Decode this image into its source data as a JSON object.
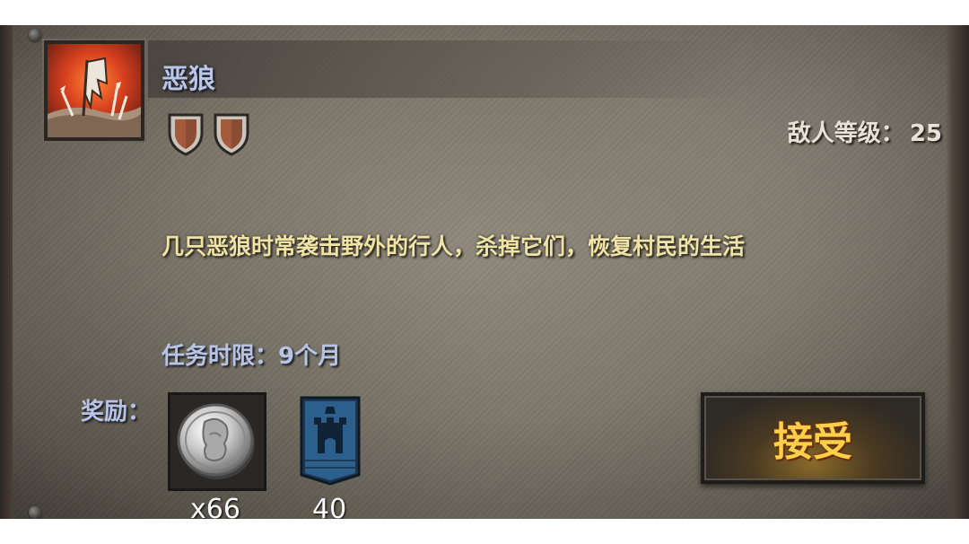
{
  "quest": {
    "title": "恶狼",
    "icon": "burning-flag-icon",
    "difficulty_shields": 2,
    "enemy_level_label": "敌人等级：",
    "enemy_level_value": "25",
    "description": "几只恶狼时常袭击野外的行人，杀掉它们，恢复村民的生活",
    "time_limit_label": "任务时限：",
    "time_limit_value": "9个月"
  },
  "rewards": {
    "label": "奖励：",
    "items": [
      {
        "icon": "silver-coin-icon",
        "count": "x66"
      },
      {
        "icon": "castle-banner-icon",
        "count": "40"
      }
    ]
  },
  "actions": {
    "accept_label": "接受"
  },
  "colors": {
    "title": "#b9c6e8",
    "description": "#efe3a6",
    "accept_text": "#ffcf4a",
    "banner_blue": "#2d5f8c"
  }
}
